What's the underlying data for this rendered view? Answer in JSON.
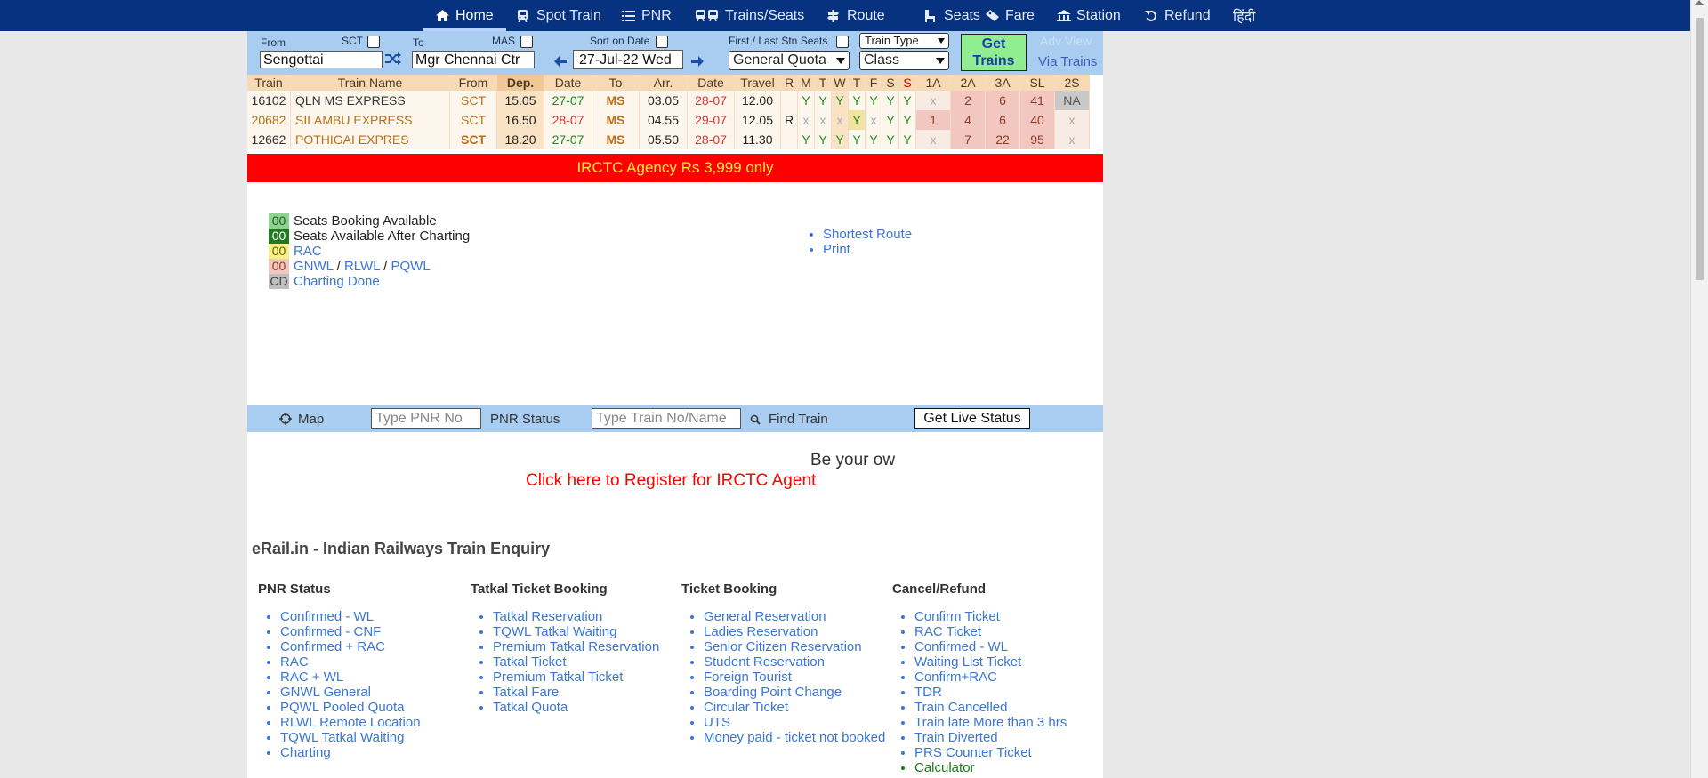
{
  "nav": {
    "items": [
      {
        "label": "Home",
        "icon": "home-icon"
      },
      {
        "label": "Spot Train",
        "icon": "train-icon"
      },
      {
        "label": "PNR",
        "icon": "list-icon"
      },
      {
        "label": "Trains/Seats",
        "icon": "trains-icon"
      },
      {
        "label": "Route",
        "icon": "signpost-icon"
      },
      {
        "label": "Seats",
        "icon": "seat-icon"
      },
      {
        "label": "Fare",
        "icon": "ticket-icon"
      },
      {
        "label": "Station",
        "icon": "station-icon"
      },
      {
        "label": "Refund",
        "icon": "undo-icon"
      },
      {
        "label": "हिंदी",
        "icon": ""
      }
    ]
  },
  "form": {
    "from_label": "From",
    "from_code": "SCT",
    "from_value": "Sengottai",
    "to_label": "To",
    "to_code": "MAS",
    "to_value": "Mgr Chennai Ctr",
    "sort_label": "Sort on Date",
    "date_value": "27-Jul-22 Wed",
    "first_last_label": "First / Last Stn Seats",
    "quota_value": "General Quota",
    "train_type_value": "Train Type",
    "class_value": "Class",
    "get_trains_line1": "Get",
    "get_trains_line2": "Trains",
    "adv_view": "Adv View",
    "via_trains": "Via Trains"
  },
  "results": {
    "headers": [
      "Train",
      "Train Name",
      "From",
      "Dep.",
      "Date",
      "To",
      "Arr.",
      "Date",
      "Travel",
      "R",
      "M",
      "T",
      "W",
      "T",
      "F",
      "S",
      "S",
      "1A",
      "2A",
      "3A",
      "SL",
      "2S"
    ],
    "rows": [
      {
        "train": "16102",
        "name": "QLN MS EXPRESS",
        "from": "SCT",
        "dep": "15.05",
        "dep_date": "27-07",
        "to": "MS",
        "arr": "03.05",
        "arr_date": "28-07",
        "travel": "12.00",
        "r": "",
        "days": [
          "Y",
          "Y",
          "Y",
          "Y",
          "Y",
          "Y",
          "Y"
        ],
        "c1a": "x",
        "c2a": "2",
        "c3a": "6",
        "csl": "41",
        "c2s": "NA"
      },
      {
        "train": "20682",
        "name": "SILAMBU EXPRESS",
        "from": "SCT",
        "dep": "16.50",
        "dep_date": "28-07",
        "to": "MS",
        "arr": "04.55",
        "arr_date": "29-07",
        "travel": "12.05",
        "r": "R",
        "days": [
          "x",
          "x",
          "x",
          "Y",
          "x",
          "Y",
          "Y"
        ],
        "c1a": "1",
        "c2a": "4",
        "c3a": "6",
        "csl": "40",
        "c2s": "x"
      },
      {
        "train": "12662",
        "name": "POTHIGAI EXPRES",
        "from": "SCT",
        "dep": "18.20",
        "dep_date": "27-07",
        "to": "MS",
        "arr": "05.50",
        "arr_date": "28-07",
        "travel": "11.30",
        "r": "",
        "days": [
          "Y",
          "Y",
          "Y",
          "Y",
          "Y",
          "Y",
          "Y"
        ],
        "c1a": "x",
        "c2a": "7",
        "c3a": "22",
        "csl": "95",
        "c2s": "x"
      }
    ]
  },
  "banner": "IRCTC Agency Rs 3,999 only",
  "legend": [
    {
      "badge": "00",
      "text": "Seats Booking Available",
      "badge_bg": "#8fd18f",
      "badge_fg": "#1d5e1d",
      "link": false
    },
    {
      "badge": "00",
      "text": "Seats Available After Charting",
      "badge_bg": "#1f7a1f",
      "badge_fg": "#ffffff",
      "link": false
    },
    {
      "badge": "00",
      "text": "RAC",
      "badge_bg": "#f3f08a",
      "badge_fg": "#6b6300",
      "link": true
    },
    {
      "badge": "00",
      "text_parts": [
        "GNWL",
        " / ",
        "RLWL",
        " / ",
        "PQWL"
      ],
      "badge_bg": "#f2c7bf",
      "badge_fg": "#8a3a2a",
      "link": true
    },
    {
      "badge": "CD",
      "text": "Charting Done",
      "badge_bg": "#bfbfbf",
      "badge_fg": "#444",
      "link": true
    }
  ],
  "side_links": [
    "Shortest Route",
    "Print"
  ],
  "tools": {
    "map_label": "Map",
    "pnr_placeholder": "Type PNR No",
    "pnr_status": "PNR Status",
    "train_placeholder": "Type Train No/Name",
    "find_train": "Find Train",
    "live_status": "Get Live Status"
  },
  "promo": {
    "marquee_text": "Be your ow",
    "register_link": "Click here to Register for IRCTC Agent"
  },
  "site_heading": "eRail.in - Indian Railways Train Enquiry",
  "sections": [
    {
      "title": "PNR Status",
      "links": [
        "Confirmed - WL",
        "Confirmed - CNF",
        "Confirmed + RAC",
        "RAC",
        "RAC + WL",
        "GNWL General",
        "PQWL Pooled Quota",
        "RLWL Remote Location",
        "TQWL Tatkal Waiting",
        "Charting"
      ]
    },
    {
      "title": "Tatkal Ticket Booking",
      "links": [
        "Tatkal Reservation",
        "TQWL Tatkal Waiting",
        "Premium Tatkal Reservation",
        "Tatkal Ticket",
        "Premium Tatkal Ticket",
        "Tatkal Fare",
        "Tatkal Quota"
      ]
    },
    {
      "title": "Ticket Booking",
      "links": [
        "General Reservation",
        "Ladies Reservation",
        "Senior Citizen Reservation",
        "Student Reservation",
        "Foreign Tourist",
        "Boarding Point Change",
        "Circular Ticket",
        "UTS",
        "Money paid - ticket not booked"
      ]
    },
    {
      "title": "Cancel/Refund",
      "links": [
        "Confirm Ticket",
        "RAC Ticket",
        "Confirmed - WL",
        "Waiting List Ticket",
        "Confirm+RAC",
        "TDR",
        "Train Cancelled",
        "Train late More than 3 hrs",
        "Train Diverted",
        "PRS Counter Ticket",
        "Calculator"
      ]
    }
  ],
  "colors": {
    "nav_bg": "#06327f",
    "form_bg": "#a9cdf0",
    "banner_bg": "#ff0000",
    "banner_fg": "#ffeb3b",
    "link": "#3a76d6",
    "calculator": "#1a7a1a",
    "register": "#ff0000"
  }
}
